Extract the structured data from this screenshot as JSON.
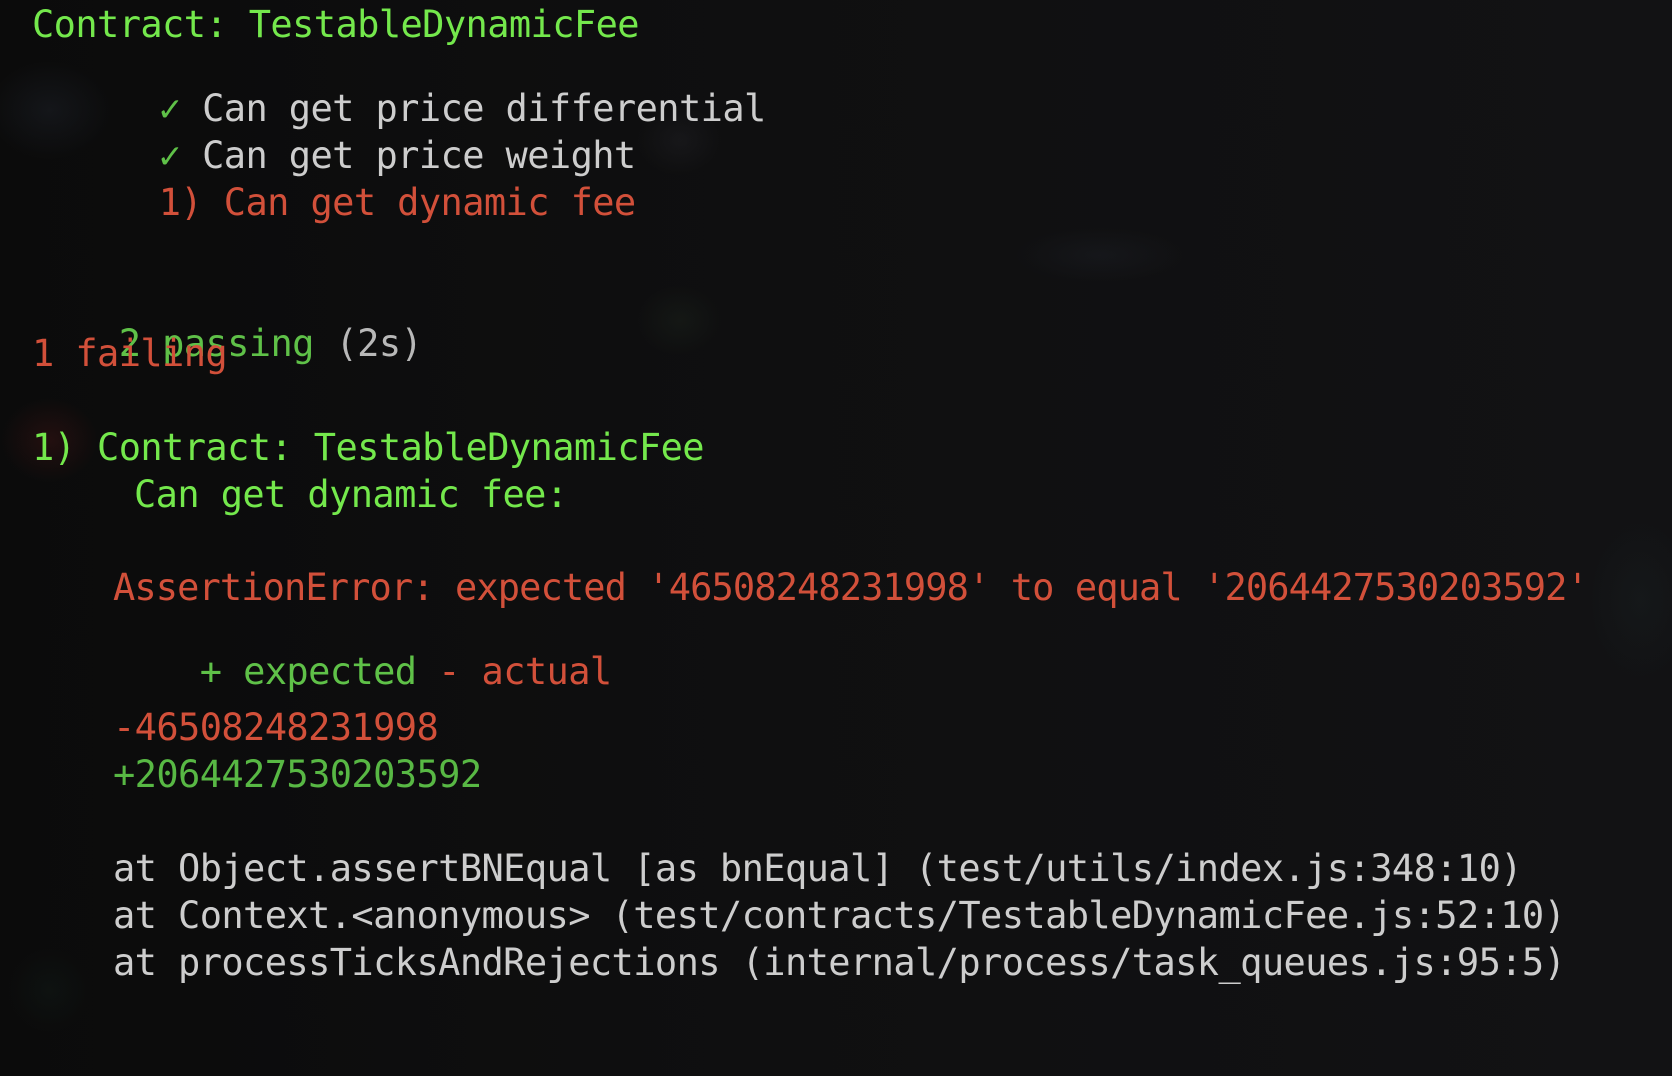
{
  "header": {
    "contract_line": "Contract: TestableDynamicFee"
  },
  "tests": [
    {
      "mark": "✓",
      "label": "Can get price differential",
      "status": "passed"
    },
    {
      "mark": "✓",
      "label": "Can get price weight",
      "status": "passed"
    },
    {
      "mark": "1)",
      "label": "Can get dynamic fee",
      "status": "failed"
    }
  ],
  "summary": {
    "passing_count": "2 passing",
    "passing_time": "(2s)",
    "failing": "1 failing"
  },
  "failure": {
    "title_line": "1) Contract: TestableDynamicFee",
    "test_line": "Can get dynamic fee:",
    "error_line": "AssertionError: expected '46508248231998' to equal '2064427530203592'",
    "diff_legend_expected": "+ expected",
    "diff_legend_actual": "- actual",
    "diff_minus": "-46508248231998",
    "diff_plus": "+2064427530203592",
    "stack": [
      "at Object.assertBNEqual [as bnEqual] (test/utils/index.js:348:10)",
      "at Context.<anonymous> (test/contracts/TestableDynamicFee.js:52:10)",
      "at processTicksAndRejections (internal/process/task_queues.js:95:5)"
    ]
  },
  "colors": {
    "background": "#0d0d0d",
    "green": "#74e84c",
    "red": "#d2503a",
    "gray": "#cdcdcd"
  }
}
